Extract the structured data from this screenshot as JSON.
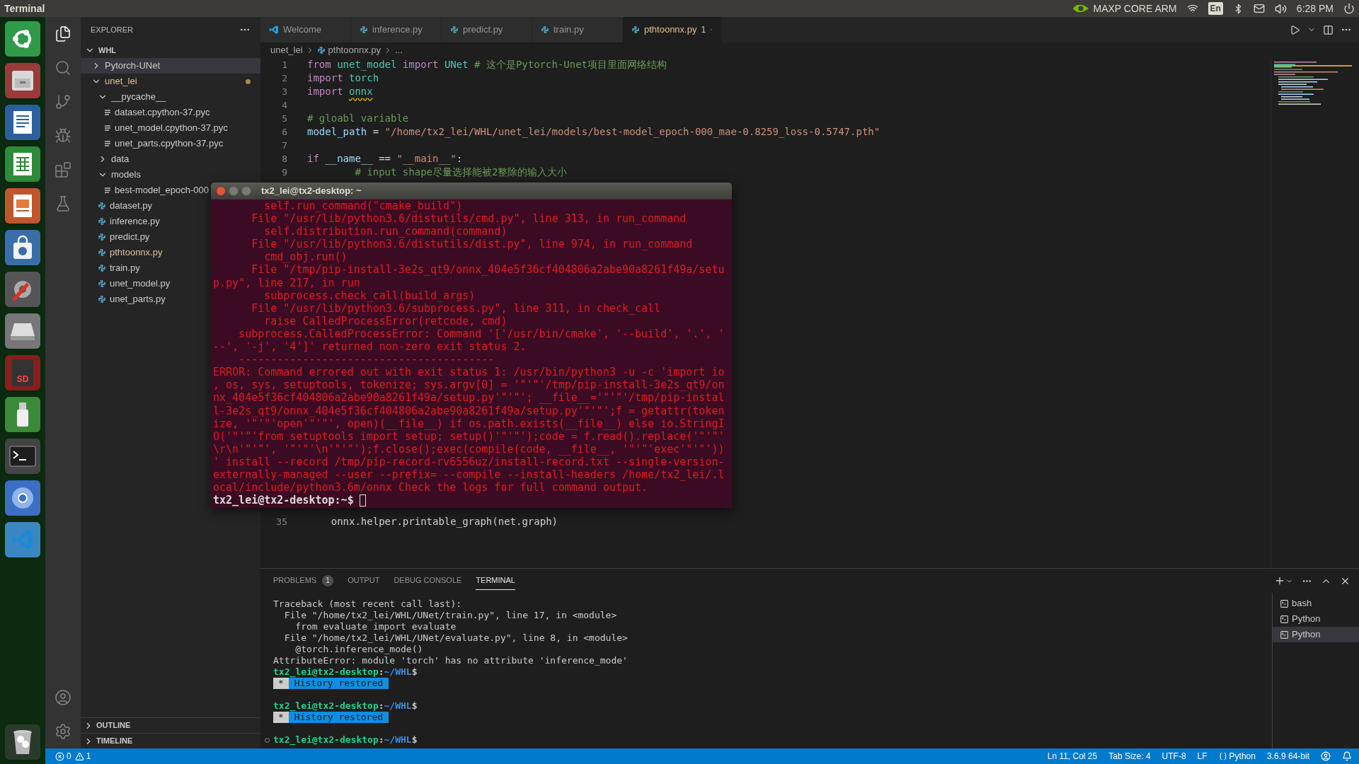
{
  "top_bar": {
    "app_title": "Terminal",
    "indicator_label": "MAXP CORE ARM",
    "keyboard_layout": "En",
    "clock": "6:28 PM"
  },
  "launcher": {
    "sd_label": "SD"
  },
  "explorer": {
    "title": "EXPLORER",
    "root": {
      "label": "WHL",
      "kind": "folder",
      "expanded": true,
      "selected": false,
      "modified": false,
      "children": [
        {
          "label": "Pytorch-UNet",
          "kind": "folder",
          "expanded": false,
          "selected": true,
          "modified": false
        },
        {
          "label": "unet_lei",
          "kind": "folder",
          "expanded": true,
          "selected": false,
          "modified": true,
          "children": [
            {
              "label": "__pycache__",
              "kind": "folder",
              "expanded": true,
              "selected": false,
              "modified": false,
              "children": [
                {
                  "label": "dataset.cpython-37.pyc",
                  "kind": "file",
                  "selected": false,
                  "modified": false
                },
                {
                  "label": "unet_model.cpython-37.pyc",
                  "kind": "file",
                  "selected": false,
                  "modified": false
                },
                {
                  "label": "unet_parts.cpython-37.pyc",
                  "kind": "file",
                  "selected": false,
                  "modified": false
                }
              ]
            },
            {
              "label": "data",
              "kind": "folder",
              "expanded": false,
              "selected": false,
              "modified": false
            },
            {
              "label": "models",
              "kind": "folder",
              "expanded": true,
              "selected": false,
              "modified": false,
              "children": [
                {
                  "label": "best-model_epoch-000",
                  "kind": "file",
                  "selected": false,
                  "modified": false
                }
              ]
            },
            {
              "label": "dataset.py",
              "kind": "pyfile",
              "selected": false,
              "modified": false
            },
            {
              "label": "inference.py",
              "kind": "pyfile",
              "selected": false,
              "modified": false
            },
            {
              "label": "predict.py",
              "kind": "pyfile",
              "selected": false,
              "modified": false
            },
            {
              "label": "pthtoonnx.py",
              "kind": "pyfile",
              "selected": false,
              "modified": true
            },
            {
              "label": "train.py",
              "kind": "pyfile",
              "selected": false,
              "modified": false
            },
            {
              "label": "unet_model.py",
              "kind": "pyfile",
              "selected": false,
              "modified": false
            },
            {
              "label": "unet_parts.py",
              "kind": "pyfile",
              "selected": false,
              "modified": false
            }
          ]
        }
      ]
    },
    "sections": [
      {
        "label": "OUTLINE",
        "expanded": false
      },
      {
        "label": "TIMELINE",
        "expanded": false
      }
    ]
  },
  "editor": {
    "tabs": [
      {
        "label": "Welcome",
        "kind": "welcome",
        "selected": false,
        "modified": false
      },
      {
        "label": "inference.py",
        "kind": "python",
        "selected": false,
        "modified": false
      },
      {
        "label": "predict.py",
        "kind": "python",
        "selected": false,
        "modified": false
      },
      {
        "label": "train.py",
        "kind": "python",
        "selected": false,
        "modified": false
      },
      {
        "label": "pthtoonnx.py",
        "kind": "python",
        "selected": true,
        "modified": true,
        "problem_count": "1"
      }
    ],
    "breadcrumb": [
      "unet_lei",
      "pthtoonnx.py",
      "..."
    ],
    "code_blocks": [
      {
        "lines": [
          {
            "number": "1",
            "tokens": [
              {
                "t": "from ",
                "kind": "keyword"
              },
              {
                "t": "unet_model ",
                "kind": "module"
              },
              {
                "t": "import ",
                "kind": "keyword"
              },
              {
                "t": "UNet ",
                "kind": "module"
              },
              {
                "t": "# 这个是Pytorch-Unet项目里面网络结构",
                "kind": "comment"
              }
            ]
          },
          {
            "number": "2",
            "tokens": [
              {
                "t": "import ",
                "kind": "keyword"
              },
              {
                "t": "torch",
                "kind": "module"
              }
            ]
          },
          {
            "number": "3",
            "tokens": [
              {
                "t": "import ",
                "kind": "keyword"
              },
              {
                "t": "onnx",
                "kind": "warning"
              }
            ]
          },
          {
            "number": "4"
          },
          {
            "number": "5",
            "tokens": [
              {
                "t": "# gloabl variable",
                "kind": "comment"
              }
            ]
          },
          {
            "number": "6",
            "tokens": [
              {
                "t": "model_path",
                "kind": "variable"
              },
              {
                "t": " = ",
                "kind": "operator"
              },
              {
                "t": "\"/home/tx2_lei/WHL/unet_lei/models/best-model_epoch-000_mae-0.8259_loss-0.5747.pth\"",
                "kind": "string"
              }
            ]
          },
          {
            "number": "7"
          },
          {
            "number": "8",
            "tokens": [
              {
                "t": "if ",
                "kind": "keyword"
              },
              {
                "t": "__name__",
                "kind": "variable"
              },
              {
                "t": " == ",
                "kind": "operator"
              },
              {
                "t": "\"__main__\"",
                "kind": "string"
              },
              {
                "t": ":",
                "kind": "operator"
              }
            ]
          },
          {
            "number": "9",
            "tokens": [
              {
                "t": "        # input shape尽量选择能被2整除的输入大小",
                "kind": "comment"
              }
            ]
          }
        ]
      },
      {
        "lines": [
          {
            "number": "35",
            "tokens": [
              {
                "t": "    onnx.helper.printable_graph(net.graph)",
                "kind": "operator"
              }
            ]
          }
        ]
      }
    ]
  },
  "terminal_window": {
    "title": "tx2_lei@tx2-desktop: ~",
    "lines": [
      "        self.run_command(\"cmake_build\")",
      "      File \"/usr/lib/python3.6/distutils/cmd.py\", line 313, in run_command",
      "        self.distribution.run_command(command)",
      "      File \"/usr/lib/python3.6/distutils/dist.py\", line 974, in run_command",
      "        cmd_obj.run()",
      "      File \"/tmp/pip-install-3e2s_qt9/onnx_404e5f36cf404806a2abe90a8261f49a/setu",
      "p.py\", line 217, in run",
      "        subprocess.check_call(build_args)",
      "      File \"/usr/lib/python3.6/subprocess.py\", line 311, in check_call",
      "        raise CalledProcessError(retcode, cmd)",
      "    subprocess.CalledProcessError: Command '['/usr/bin/cmake', '--build', '.', '",
      "--', '-j', '4']' returned non-zero exit status 2.",
      "    ----------------------------------------",
      "ERROR: Command errored out with exit status 1: /usr/bin/python3 -u -c 'import io",
      ", os, sys, setuptools, tokenize; sys.argv[0] = '\"'\"'/tmp/pip-install-3e2s_qt9/on",
      "nx_404e5f36cf404806a2abe90a8261f49a/setup.py'\"'\"'; __file__='\"'\"'/tmp/pip-instal",
      "l-3e2s_qt9/onnx_404e5f36cf404806a2abe90a8261f49a/setup.py'\"'\"';f = getattr(token",
      "ize, '\"'\"'open'\"'\"', open)(__file__) if os.path.exists(__file__) else io.StringI",
      "O('\"'\"'from setuptools import setup; setup()'\"'\"');code = f.read().replace('\"'\"'",
      "\\r\\n'\"'\"', '\"'\"'\\n'\"'\"');f.close();exec(compile(code, __file__, '\"'\"'exec'\"'\"'))",
      "' install --record /tmp/pip-record-rv6556uz/install-record.txt --single-version-",
      "externally-managed --user --prefix= --compile --install-headers /home/tx2_lei/.l",
      "ocal/include/python3.6m/onnx Check the logs for full command output."
    ],
    "prompt": "tx2_lei@tx2-desktop:~$"
  },
  "panel": {
    "tabs": [
      {
        "label": "PROBLEMS",
        "badge": "1",
        "selected": false
      },
      {
        "label": "OUTPUT",
        "selected": false
      },
      {
        "label": "DEBUG CONSOLE",
        "selected": false
      },
      {
        "label": "TERMINAL",
        "selected": true
      }
    ],
    "terminal_lines": [
      {
        "kind": "text",
        "text": "Traceback (most recent call last):"
      },
      {
        "kind": "text",
        "text": "  File \"/home/tx2_lei/WHL/UNet/train.py\", line 17, in <module>"
      },
      {
        "kind": "text",
        "text": "    from evaluate import evaluate"
      },
      {
        "kind": "text",
        "text": "  File \"/home/tx2_lei/WHL/UNet/evaluate.py\", line 8, in <module>"
      },
      {
        "kind": "text",
        "text": "    @torch.inference_mode()"
      },
      {
        "kind": "text",
        "text": "AttributeError: module 'torch' has no attribute 'inference_mode'"
      },
      {
        "kind": "prompt",
        "marker": false,
        "user": "tx2_lei@tx2-desktop",
        "sep": ":",
        "path": "~/WHL",
        "end": "$"
      },
      {
        "kind": "badge",
        "mark": "*",
        "text": "History restored"
      },
      {
        "kind": "blank"
      },
      {
        "kind": "prompt",
        "marker": false,
        "user": "tx2_lei@tx2-desktop",
        "sep": ":",
        "path": "~/WHL",
        "end": "$"
      },
      {
        "kind": "badge",
        "mark": "*",
        "text": "History restored"
      },
      {
        "kind": "blank"
      },
      {
        "kind": "prompt",
        "marker": true,
        "user": "tx2_lei@tx2-desktop",
        "sep": ":",
        "path": "~/WHL",
        "end": "$"
      }
    ],
    "terminals": [
      {
        "label": "bash",
        "selected": false
      },
      {
        "label": "Python",
        "selected": false
      },
      {
        "label": "Python",
        "selected": true
      }
    ]
  },
  "status_bar": {
    "errors": "0",
    "warnings": "1",
    "items": [
      {
        "text": "Ln 11, Col 25",
        "kind": "plain"
      },
      {
        "text": "Tab Size: 4",
        "kind": "plain"
      },
      {
        "text": "UTF-8",
        "kind": "plain"
      },
      {
        "text": "LF",
        "kind": "plain"
      },
      {
        "text": "Python",
        "kind": "language"
      },
      {
        "text": "3.6.9 64-bit",
        "kind": "plain"
      }
    ]
  }
}
